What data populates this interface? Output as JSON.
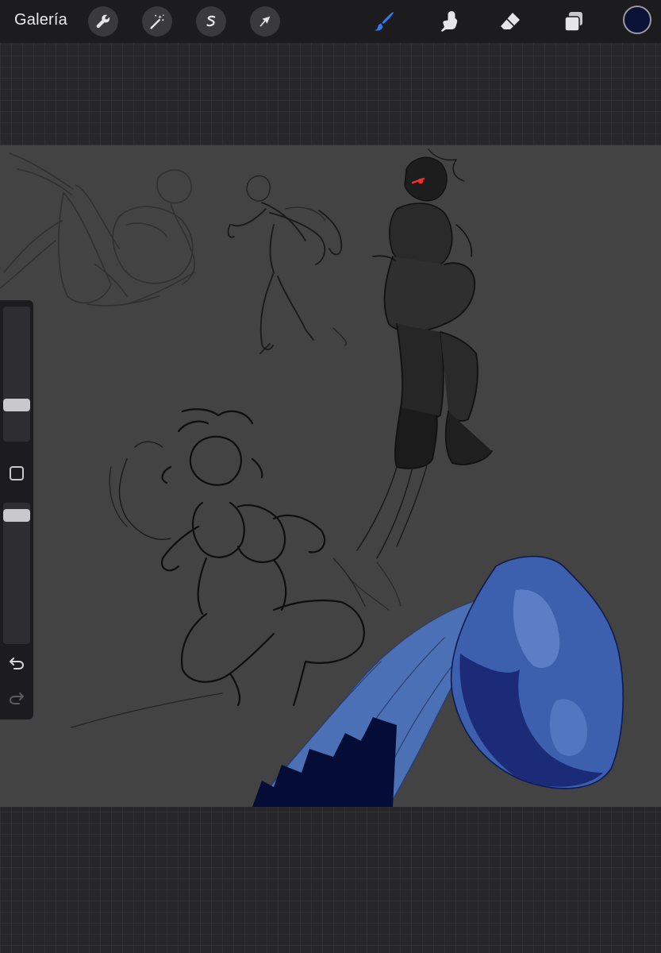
{
  "toolbar": {
    "gallery_label": "Galería",
    "left_tools": [
      {
        "name": "actions-tool",
        "icon": "wrench-icon"
      },
      {
        "name": "adjustments-tool",
        "icon": "magic-wand-icon"
      },
      {
        "name": "selection-tool",
        "icon": "selection-s-icon"
      },
      {
        "name": "transform-tool",
        "icon": "arrow-cursor-icon"
      }
    ],
    "right_tools": [
      {
        "name": "brush-tool",
        "icon": "brush-icon",
        "active": true
      },
      {
        "name": "smudge-tool",
        "icon": "smudge-finger-icon",
        "active": false
      },
      {
        "name": "eraser-tool",
        "icon": "eraser-icon",
        "active": false
      },
      {
        "name": "layers-tool",
        "icon": "layers-icon",
        "active": false
      }
    ],
    "current_color": "#0b1238",
    "active_color": "#2e7cf6",
    "icon_color": "#e6e6e8"
  },
  "sidebar": {
    "brush_size_level": 0.25,
    "opacity_level": 0.95,
    "modifier_icon": "square-modifier-icon",
    "undo_icon": "undo-icon",
    "redo_icon": "redo-icon"
  },
  "canvas": {
    "background": "#434343",
    "sketch_color": "#151515",
    "fabric_color": "#4b70b6",
    "shape_color": "#3c5fae",
    "dark_blue": "#050c35",
    "eye_color": "#ff2a2a"
  }
}
